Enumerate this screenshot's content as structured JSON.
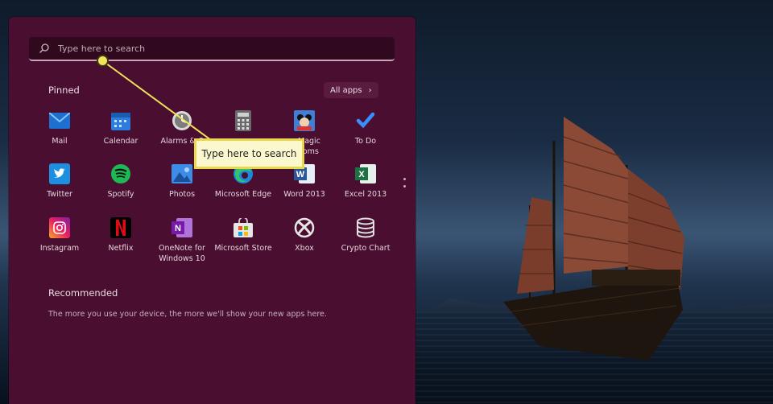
{
  "search": {
    "placeholder": "Type here to search"
  },
  "pinned": {
    "title": "Pinned",
    "all_apps_label": "All apps",
    "apps": [
      {
        "label": "Mail",
        "icon": "mail-icon"
      },
      {
        "label": "Calendar",
        "icon": "calendar-icon"
      },
      {
        "label": "Alarms & C",
        "icon": "clock-icon"
      },
      {
        "label": "",
        "icon": "calculator-icon"
      },
      {
        "label": "Magic\nooms",
        "icon": "game-icon"
      },
      {
        "label": "To Do",
        "icon": "todo-icon"
      },
      {
        "label": "Twitter",
        "icon": "twitter-icon"
      },
      {
        "label": "Spotify",
        "icon": "spotify-icon"
      },
      {
        "label": "Photos",
        "icon": "photos-icon"
      },
      {
        "label": "Microsoft Edge",
        "icon": "edge-icon"
      },
      {
        "label": "Word 2013",
        "icon": "word-icon"
      },
      {
        "label": "Excel 2013",
        "icon": "excel-icon"
      },
      {
        "label": "Instagram",
        "icon": "instagram-icon"
      },
      {
        "label": "Netflix",
        "icon": "netflix-icon"
      },
      {
        "label": "OneNote for\nWindows 10",
        "icon": "onenote-icon"
      },
      {
        "label": "Microsoft Store",
        "icon": "store-icon"
      },
      {
        "label": "Xbox",
        "icon": "xbox-icon"
      },
      {
        "label": "Crypto Chart",
        "icon": "crypto-icon"
      }
    ]
  },
  "recommended": {
    "title": "Recommended",
    "text": "The more you use your device, the more we'll show your new apps here."
  },
  "callout": {
    "text": "Type here to search"
  },
  "colors": {
    "menu_bg": "#4a0f30",
    "search_bg": "#31091f",
    "callout_yellow": "#e9d84a"
  }
}
